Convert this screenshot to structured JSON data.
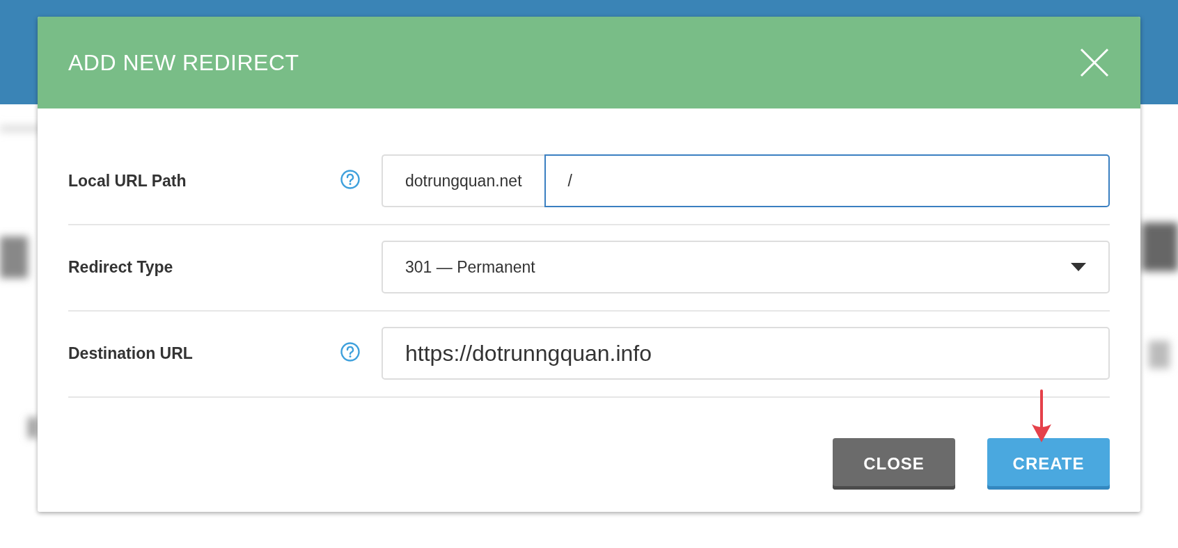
{
  "dialog": {
    "title": "ADD NEW REDIRECT",
    "fields": [
      {
        "kind": "prefixed",
        "label": "Local URL Path",
        "help": true,
        "prefix": "dotrungquan.net",
        "value": "/",
        "focused": true
      },
      {
        "kind": "select",
        "label": "Redirect Type",
        "help": false,
        "value": "301 — Permanent"
      },
      {
        "kind": "text",
        "label": "Destination URL",
        "help": true,
        "value": "https://dotrunngquan.info",
        "focused": false
      }
    ],
    "buttons": [
      {
        "label": "CLOSE",
        "kind": "secondary"
      },
      {
        "label": "CREATE",
        "kind": "primary"
      }
    ]
  }
}
